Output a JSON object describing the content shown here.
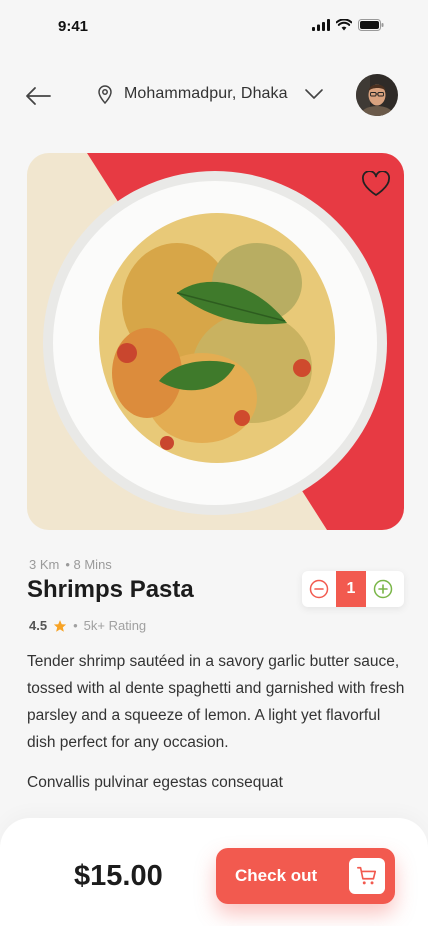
{
  "status_bar": {
    "time": "9:41"
  },
  "header": {
    "location": "Mohammadpur, Dhaka"
  },
  "product": {
    "distance": "3 Km",
    "duration": "• 8 Mins",
    "name": "Shrimps Pasta",
    "rating": "4.5",
    "rating_separator": "•",
    "rating_count": "5k+ Rating",
    "quantity": "1",
    "description": "Tender shrimp sautéed in a savory garlic butter sauce, tossed with al dente spaghetti and garnished with fresh parsley and a squeeze of lemon. A light yet flavorful dish perfect for any occasion.",
    "extra_note": "Convallis pulvinar egestas consequat"
  },
  "checkout": {
    "price": "$15.00",
    "label": "Check out"
  },
  "colors": {
    "accent": "#f25a4f",
    "plus": "#7ab648",
    "star": "#f7a325"
  }
}
